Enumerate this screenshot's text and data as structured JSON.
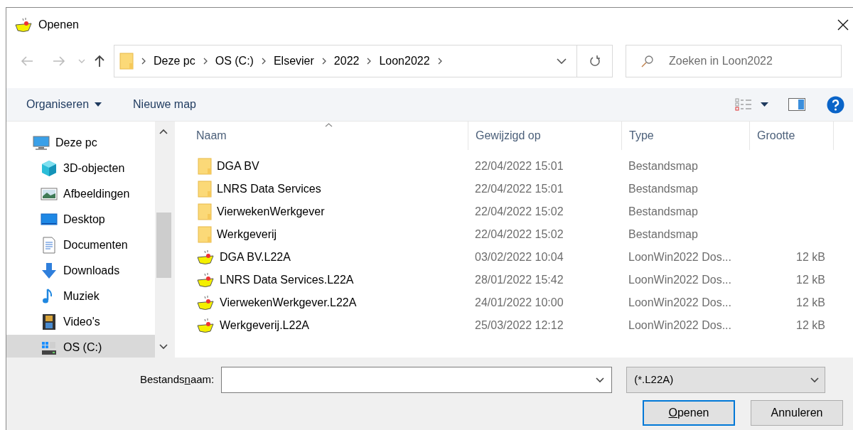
{
  "window": {
    "title": "Openen"
  },
  "address": {
    "breadcrumbs": [
      "Deze pc",
      "OS (C:)",
      "Elsevier",
      "2022",
      "Loon2022"
    ]
  },
  "search": {
    "placeholder": "Zoeken in Loon2022"
  },
  "toolbar": {
    "buttons": [
      {
        "label": "Organiseren",
        "dropdown": true
      },
      {
        "label": "Nieuwe map",
        "dropdown": false
      }
    ]
  },
  "sidebar": {
    "items": [
      {
        "label": "Deze pc",
        "kind": "computer",
        "selected": false,
        "children": [
          {
            "label": "3D-objecten",
            "kind": "objects3d",
            "selected": false
          },
          {
            "label": "Afbeeldingen",
            "kind": "pictures",
            "selected": false
          },
          {
            "label": "Desktop",
            "kind": "desktop",
            "selected": false
          },
          {
            "label": "Documenten",
            "kind": "documents",
            "selected": false
          },
          {
            "label": "Downloads",
            "kind": "downloads",
            "selected": false
          },
          {
            "label": "Muziek",
            "kind": "music",
            "selected": false
          },
          {
            "label": "Video's",
            "kind": "videos",
            "selected": false
          },
          {
            "label": "OS (C:)",
            "kind": "drive",
            "selected": true
          }
        ]
      }
    ]
  },
  "files": {
    "columns": [
      "Naam",
      "Gewijzigd op",
      "Type",
      "Grootte"
    ],
    "rows": [
      {
        "kind": "folder",
        "name": "DGA BV",
        "modified": "22/04/2022 15:01",
        "type": "Bestandsmap"
      },
      {
        "kind": "folder",
        "name": "LNRS Data Services",
        "modified": "22/04/2022 15:01",
        "type": "Bestandsmap"
      },
      {
        "kind": "folder",
        "name": "VierwekenWerkgever",
        "modified": "22/04/2022 15:02",
        "type": "Bestandsmap"
      },
      {
        "kind": "folder",
        "name": "Werkgeverij",
        "modified": "22/04/2022 15:02",
        "type": "Bestandsmap"
      },
      {
        "kind": "file",
        "name": "DGA BV.L22A",
        "modified": "03/02/2022 10:04",
        "type": "LoonWin2022 Dos...",
        "size": "12 kB"
      },
      {
        "kind": "file",
        "name": "LNRS Data Services.L22A",
        "modified": "28/01/2022 15:42",
        "type": "LoonWin2022 Dos...",
        "size": "12 kB"
      },
      {
        "kind": "file",
        "name": "VierwekenWerkgever.L22A",
        "modified": "24/01/2022 10:00",
        "type": "LoonWin2022 Dos...",
        "size": "12 kB"
      },
      {
        "kind": "file",
        "name": "Werkgeverij.L22A",
        "modified": "25/03/2022 12:12",
        "type": "LoonWin2022 Dos...",
        "size": "12 kB"
      }
    ]
  },
  "filename": {
    "label": {
      "before": "Bestands",
      "access_key": "n",
      "after": "aam:"
    }
  },
  "filter": {
    "value": "(*.L22A)"
  },
  "buttons": [
    {
      "access_key": "O",
      "rest": "penen",
      "default": true
    },
    {
      "label": "Annuleren",
      "default": false
    }
  ]
}
